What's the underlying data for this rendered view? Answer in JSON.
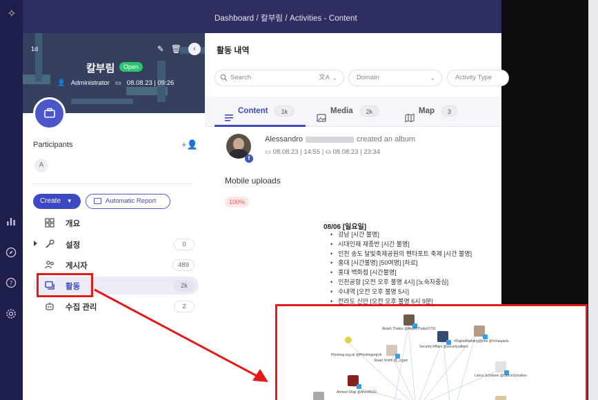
{
  "app": {
    "breadcrumb": "Dashboard / 칼부림 / Activities - Content"
  },
  "case": {
    "age": "1d",
    "title": "칼부림",
    "status": "Open",
    "role": "Administrator",
    "created": "08.08.23 | 09:26"
  },
  "participants": {
    "label": "Participants",
    "chip": "A"
  },
  "actions": {
    "create_label": "Create",
    "report_label": "Automatic Report"
  },
  "menu": [
    {
      "label": "개요",
      "count": ""
    },
    {
      "label": "설정",
      "count": "0"
    },
    {
      "label": "게시자",
      "count": "489"
    },
    {
      "label": "활동",
      "count": "2k"
    },
    {
      "label": "수집 관리",
      "count": "2"
    }
  ],
  "main": {
    "title": "활동 내역",
    "search_placeholder": "Search",
    "domain_placeholder": "Domain",
    "activity_type_placeholder": "Activity Type",
    "tabs": [
      {
        "label": "Content",
        "count": "1k"
      },
      {
        "label": "Media",
        "count": "2k"
      },
      {
        "label": "Map",
        "count": "3"
      }
    ]
  },
  "post": {
    "author": "Alessandro",
    "action": "created an album",
    "time_posted": "08.08.23 | 14:55",
    "time_collected": "08.08.23 | 23:34",
    "text": "Mobile uploads",
    "score": "100%",
    "date_heading": "08/06 [일요일]",
    "entries": [
      "강남 [시간 불명]",
      "시대인재 재종반 [시간 불명]",
      "인천 송도 달빛축제공원의 펜타포트 축제 [시간 불명]",
      "홍대 [시간불명] [50여명] [차로]",
      "홍대 백화점 [시간불명]",
      "인천공항 [오전 오후 불명 4시] [노숙자중심]",
      "수내역 [오전 오후 불명 5시]",
      "전라도 신안 [오전 오후 불명 6시 9분]"
    ]
  },
  "graph": {
    "nodes": [
      {
        "label": "Akash Thakur @AkashThakur2791"
      },
      {
        "label": "Security Affairs @securityaffairs"
      },
      {
        "label": "#DigitalMarkting@one @richaujaslu"
      },
      {
        "label": "Phishing.org.uk @PhishingorgUk"
      },
      {
        "label": "Stuart Smith @_rcgun"
      },
      {
        "label": "Lance Schukies @LanceSchukies"
      },
      {
        "label": "Ahmed Shaji @Ahm9b111"
      }
    ]
  },
  "colors": {
    "accent": "#3d49c4",
    "annotation": "#e21a1a",
    "open_badge": "#2cc46e"
  }
}
